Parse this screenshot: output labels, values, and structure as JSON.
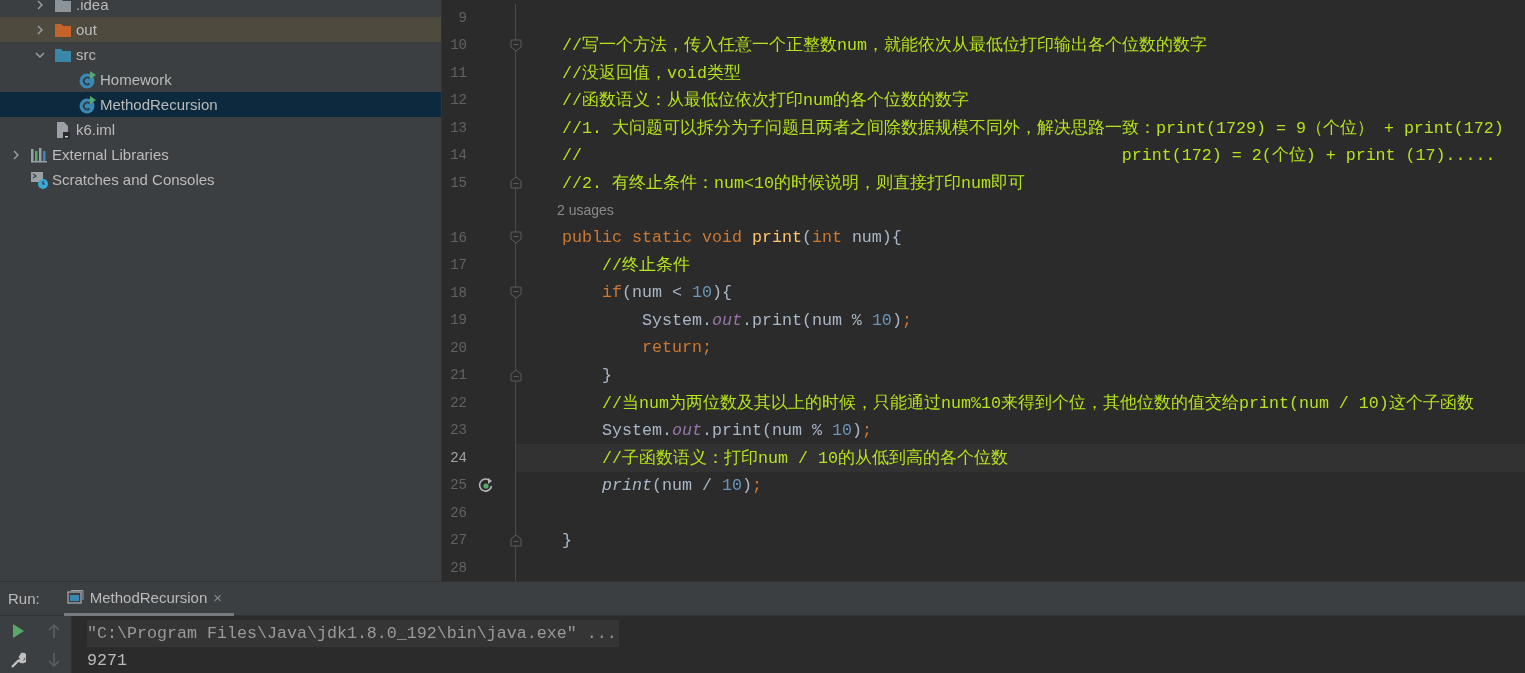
{
  "project_tree": {
    "items": [
      {
        "children": [
          {
            "label": ".idea",
            "kind": "folder",
            "color": "#8c9399",
            "expanded": false,
            "selected": false,
            "highlighted": false
          },
          {
            "label": "out",
            "kind": "folder",
            "color": "#c5632b",
            "expanded": false,
            "selected": false,
            "highlighted": true
          },
          {
            "label": "src",
            "kind": "folder",
            "color": "#3b87a8",
            "expanded": true,
            "selected": false,
            "highlighted": false,
            "children": [
              {
                "label": "Homework",
                "kind": "class",
                "selected": false,
                "highlighted": false
              },
              {
                "label": "MethodRecursion",
                "kind": "class",
                "selected": true,
                "highlighted": false
              }
            ]
          },
          {
            "label": "k6.iml",
            "kind": "file",
            "selected": false,
            "highlighted": false
          }
        ]
      },
      {
        "label": "External Libraries",
        "kind": "libraries",
        "expanded": false,
        "selected": false,
        "highlighted": false
      },
      {
        "label": "Scratches and Consoles",
        "kind": "scratches",
        "selected": false,
        "highlighted": false
      }
    ]
  },
  "editor": {
    "lines": [
      {
        "kind": "code",
        "number": "9",
        "current": false
      },
      {
        "kind": "code",
        "number": "10",
        "fold": {
          "kind": "start"
        },
        "current": false,
        "tokens": [
          {
            "kind": "comment",
            "text": "    //写一个方法，传入任意一个正整数num，就能依次从最低位打印输出各个位数的数字"
          }
        ]
      },
      {
        "kind": "code",
        "number": "11",
        "current": false,
        "tokens": [
          {
            "kind": "comment",
            "text": "    //没返回值，void类型"
          }
        ]
      },
      {
        "kind": "code",
        "number": "12",
        "current": false,
        "tokens": [
          {
            "kind": "comment",
            "text": "    //函数语义：从最低位依次打印num的各个位数的数字"
          }
        ]
      },
      {
        "kind": "code",
        "number": "13",
        "current": false,
        "tokens": [
          {
            "kind": "comment",
            "text": "    //1. 大问题可以拆分为子问题且两者之间除数据规模不同外，解决思路一致：print(1729) = 9（个位） + print(172)"
          }
        ]
      },
      {
        "kind": "code",
        "number": "14",
        "current": false,
        "tokens": [
          {
            "kind": "comment",
            "text": "    //                                                      print(172) = 2(个位) + print (17)....."
          }
        ]
      },
      {
        "kind": "code",
        "number": "15",
        "fold": {
          "kind": "end"
        },
        "current": false,
        "tokens": [
          {
            "kind": "comment",
            "text": "    //2. 有终止条件：num<10的时候说明，则直接打印num即可"
          }
        ]
      },
      {
        "kind": "inlay",
        "text": "2 usages"
      },
      {
        "kind": "code",
        "number": "16",
        "fold": {
          "kind": "start"
        },
        "current": false,
        "tokens": [
          {
            "kind": "keyword",
            "text": "    public static void "
          },
          {
            "kind": "declaration",
            "text": "print"
          },
          {
            "kind": "plain",
            "text": "("
          },
          {
            "kind": "keyword",
            "text": "int "
          },
          {
            "kind": "plain",
            "text": "num){"
          }
        ]
      },
      {
        "kind": "code",
        "number": "17",
        "current": false,
        "tokens": [
          {
            "kind": "comment",
            "text": "        //终止条件"
          }
        ]
      },
      {
        "kind": "code",
        "number": "18",
        "fold": {
          "kind": "start"
        },
        "current": false,
        "tokens": [
          {
            "kind": "keyword",
            "text": "        if"
          },
          {
            "kind": "plain",
            "text": "(num < "
          },
          {
            "kind": "number",
            "text": "10"
          },
          {
            "kind": "plain",
            "text": "){"
          }
        ]
      },
      {
        "kind": "code",
        "number": "19",
        "current": false,
        "tokens": [
          {
            "kind": "plain",
            "text": "            System."
          },
          {
            "kind": "field",
            "text": "out"
          },
          {
            "kind": "plain",
            "text": ".print(num % "
          },
          {
            "kind": "number",
            "text": "10"
          },
          {
            "kind": "plain",
            "text": ")"
          },
          {
            "kind": "keyword",
            "text": ";"
          }
        ]
      },
      {
        "kind": "code",
        "number": "20",
        "current": false,
        "tokens": [
          {
            "kind": "keyword",
            "text": "            return;"
          }
        ]
      },
      {
        "kind": "code",
        "number": "21",
        "fold": {
          "kind": "end"
        },
        "current": false,
        "tokens": [
          {
            "kind": "plain",
            "text": "        }"
          }
        ]
      },
      {
        "kind": "code",
        "number": "22",
        "current": false,
        "tokens": [
          {
            "kind": "comment",
            "text": "        //当num为两位数及其以上的时候，只能通过num%10来得到个位，其他位数的值交给print(num / 10)这个子函数"
          }
        ]
      },
      {
        "kind": "code",
        "number": "23",
        "current": false,
        "tokens": [
          {
            "kind": "plain",
            "text": "        System."
          },
          {
            "kind": "field",
            "text": "out"
          },
          {
            "kind": "plain",
            "text": ".print(num % "
          },
          {
            "kind": "number",
            "text": "10"
          },
          {
            "kind": "plain",
            "text": ")"
          },
          {
            "kind": "keyword",
            "text": ";"
          }
        ]
      },
      {
        "kind": "code",
        "number": "24",
        "current": true,
        "tokens": [
          {
            "kind": "comment",
            "text": "        //子函数语义：打印num / 10的从低到高的各个位数"
          }
        ]
      },
      {
        "kind": "code",
        "number": "25",
        "gutter_icon": {
          "kind": "recursion"
        },
        "current": false,
        "tokens": [
          {
            "kind": "call",
            "text": "        print"
          },
          {
            "kind": "plain",
            "text": "(num / "
          },
          {
            "kind": "number",
            "text": "10"
          },
          {
            "kind": "plain",
            "text": ")"
          },
          {
            "kind": "keyword",
            "text": ";"
          }
        ]
      },
      {
        "kind": "code",
        "number": "26",
        "current": false
      },
      {
        "kind": "code",
        "number": "27",
        "fold": {
          "kind": "end"
        },
        "current": false,
        "tokens": [
          {
            "kind": "plain",
            "text": "    }"
          }
        ]
      },
      {
        "kind": "code",
        "number": "28",
        "current": false
      }
    ]
  },
  "run_panel": {
    "label": "Run:",
    "tabs": [
      {
        "label": "MethodRecursion",
        "close": "×",
        "selected": true
      }
    ],
    "toolbar": [
      {
        "kind": "run",
        "disabled": false
      },
      {
        "kind": "up",
        "disabled": true
      },
      {
        "kind": "wrench",
        "disabled": false
      },
      {
        "kind": "down",
        "disabled": true
      }
    ],
    "console": [
      {
        "kind": "command",
        "text": "\"C:\\Program Files\\Java\\jdk1.8.0_192\\bin\\java.exe\" ..."
      },
      {
        "kind": "output",
        "text": "9271"
      }
    ]
  }
}
